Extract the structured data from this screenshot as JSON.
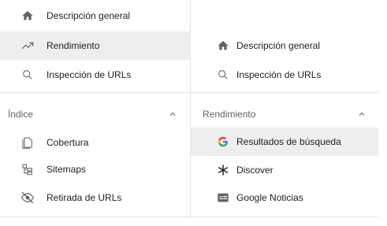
{
  "left_nav": {
    "items_top": [
      {
        "label": "Descripción general",
        "icon": "home-icon"
      },
      {
        "label": "Rendimiento",
        "icon": "trending-up-icon",
        "selected": true
      },
      {
        "label": "Inspección de URLs",
        "icon": "search-icon"
      }
    ],
    "section": {
      "label": "Índice",
      "chevron": "chevron-up-icon"
    },
    "items_section": [
      {
        "label": "Cobertura",
        "icon": "coverage-icon"
      },
      {
        "label": "Sitemaps",
        "icon": "sitemap-icon"
      },
      {
        "label": "Retirada de URLs",
        "icon": "visibility-off-icon"
      }
    ]
  },
  "right_nav": {
    "items_top": [
      {
        "label": "Descripción general",
        "icon": "home-icon"
      },
      {
        "label": "Inspección de URLs",
        "icon": "search-icon"
      }
    ],
    "section": {
      "label": "Rendimiento",
      "chevron": "chevron-up-icon"
    },
    "items_section": [
      {
        "label": "Resultados de búsqueda",
        "icon": "google-g-icon",
        "selected": true
      },
      {
        "label": "Discover",
        "icon": "asterisk-icon"
      },
      {
        "label": "Google Noticias",
        "icon": "google-news-icon"
      }
    ]
  },
  "colors": {
    "selected_bg": "#eeeeee",
    "icon_gray": "#5f6368",
    "text": "#202124",
    "google_blue": "#4285f4",
    "google_red": "#ea4335",
    "google_yellow": "#fbbc05",
    "google_green": "#34a853"
  }
}
